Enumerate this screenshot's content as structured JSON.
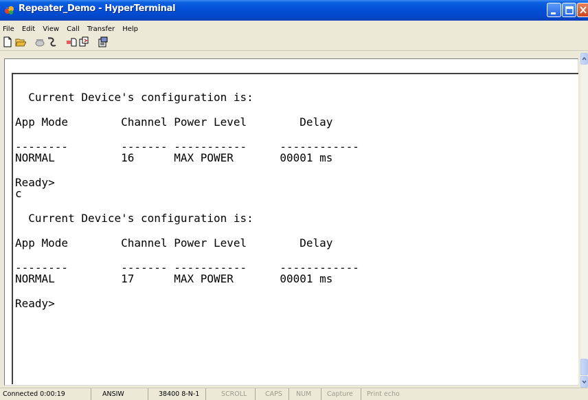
{
  "window": {
    "title": "Repeater_Demo - HyperTerminal",
    "icons": {
      "app": "hyperterminal-icon",
      "minimize": "minimize-icon",
      "maximize": "maximize-icon",
      "close": "close-icon"
    }
  },
  "menu": {
    "items": [
      "File",
      "Edit",
      "View",
      "Call",
      "Transfer",
      "Help"
    ]
  },
  "toolbar": {
    "buttons": [
      "new-connection-icon",
      "open-icon",
      "call-icon",
      "disconnect-icon",
      "send-icon",
      "receive-icon",
      "properties-icon"
    ]
  },
  "terminal": {
    "lines": [
      "  Current Device's configuration is:",
      "App Mode        Channel Power Level        Delay",
      "--------        ------- -----------     ------------",
      "NORMAL          16      MAX POWER       00001 ms",
      "Ready>",
      "c",
      "  Current Device's configuration is:",
      "App Mode        Channel Power Level        Delay",
      "--------        ------- -----------     ------------",
      "NORMAL          17      MAX POWER       00001 ms",
      "Ready>"
    ]
  },
  "status": {
    "connected": "Connected 0:00:19",
    "emulation": "ANSIW",
    "port_settings": "38400 8-N-1",
    "scroll": "SCROLL",
    "caps": "CAPS",
    "num": "NUM",
    "capture": "Capture",
    "print_echo": "Print echo"
  }
}
